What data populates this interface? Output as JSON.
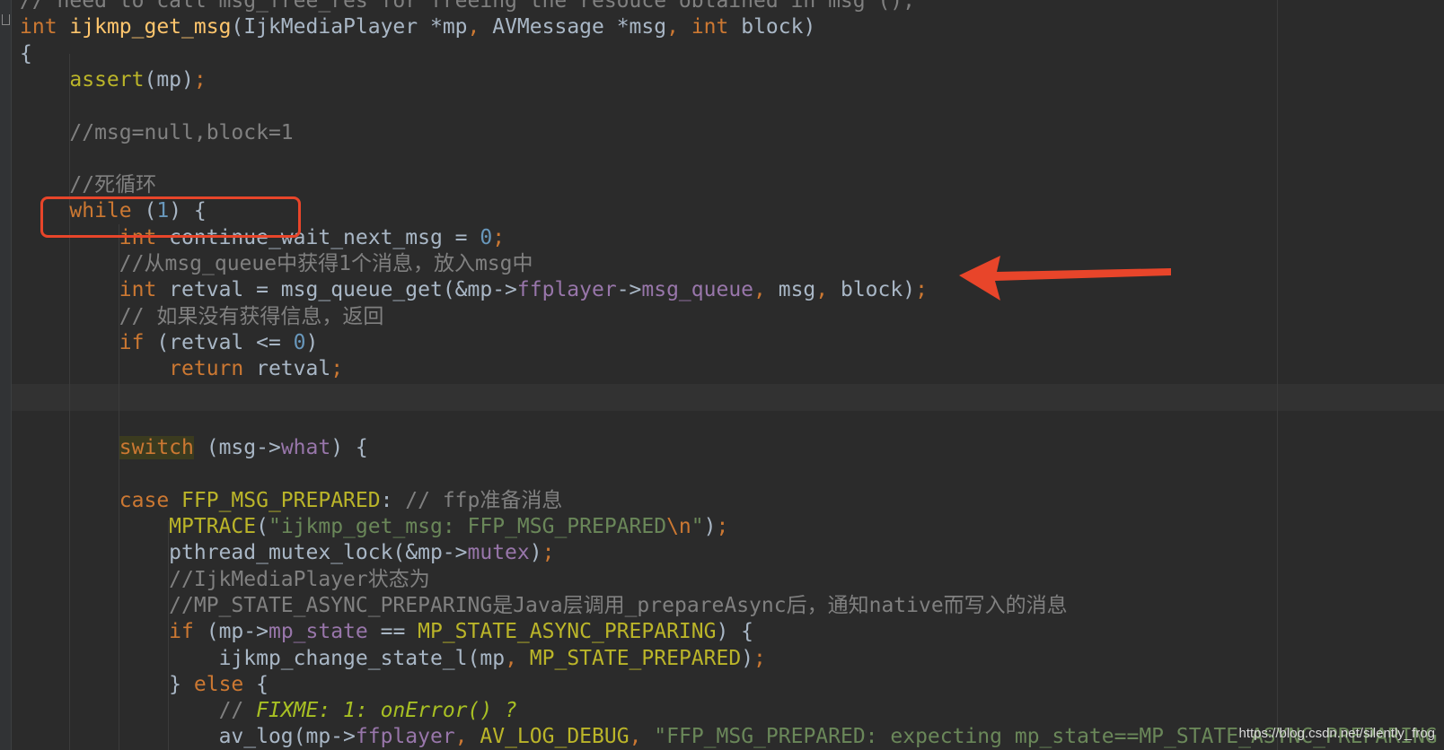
{
  "editor": {
    "lines": [
      {
        "segments": [
          {
            "t": "// need to call msg_free_res for freeing the resouce obtained in msg ();",
            "c": "cm"
          }
        ]
      },
      {
        "segments": [
          {
            "t": "int",
            "c": "kw"
          },
          {
            "t": " "
          },
          {
            "t": "ijkmp_get_msg",
            "c": "fn"
          },
          {
            "t": "(IjkMediaPlayer *mp"
          },
          {
            "t": ",",
            "c": "kw"
          },
          {
            "t": " AVMessage *msg"
          },
          {
            "t": ",",
            "c": "kw"
          },
          {
            "t": " "
          },
          {
            "t": "int",
            "c": "kw"
          },
          {
            "t": " block)"
          }
        ]
      },
      {
        "segments": [
          {
            "t": "{"
          }
        ]
      },
      {
        "segments": [
          {
            "t": "    "
          },
          {
            "t": "assert",
            "c": "mac"
          },
          {
            "t": "(mp)"
          },
          {
            "t": ";",
            "c": "kw"
          }
        ]
      },
      {
        "segments": [
          {
            "t": ""
          }
        ]
      },
      {
        "segments": [
          {
            "t": "    "
          },
          {
            "t": "//msg=null,block=1",
            "c": "cm"
          }
        ]
      },
      {
        "segments": [
          {
            "t": ""
          }
        ]
      },
      {
        "segments": [
          {
            "t": "    "
          },
          {
            "t": "//死循环",
            "c": "cm"
          }
        ]
      },
      {
        "segments": [
          {
            "t": "    "
          },
          {
            "t": "while",
            "c": "kw"
          },
          {
            "t": " ("
          },
          {
            "t": "1",
            "c": "num"
          },
          {
            "t": ") {"
          }
        ]
      },
      {
        "segments": [
          {
            "t": "        "
          },
          {
            "t": "int",
            "c": "kw"
          },
          {
            "t": " continue_wait_next_msg = "
          },
          {
            "t": "0",
            "c": "num"
          },
          {
            "t": ";",
            "c": "kw"
          }
        ]
      },
      {
        "segments": [
          {
            "t": "        "
          },
          {
            "t": "//从msg_queue中获得1个消息，放入msg中",
            "c": "cm"
          }
        ]
      },
      {
        "segments": [
          {
            "t": "        "
          },
          {
            "t": "int",
            "c": "kw"
          },
          {
            "t": " retval = msg_queue_get(&mp->"
          },
          {
            "t": "ffplayer",
            "c": "fld"
          },
          {
            "t": "->"
          },
          {
            "t": "msg_queue",
            "c": "fld"
          },
          {
            "t": ",",
            "c": "kw"
          },
          {
            "t": " msg"
          },
          {
            "t": ",",
            "c": "kw"
          },
          {
            "t": " block)"
          },
          {
            "t": ";",
            "c": "kw"
          }
        ]
      },
      {
        "segments": [
          {
            "t": "        "
          },
          {
            "t": "// 如果没有获得信息，返回",
            "c": "cm"
          }
        ]
      },
      {
        "segments": [
          {
            "t": "        "
          },
          {
            "t": "if",
            "c": "kw"
          },
          {
            "t": " (retval <= "
          },
          {
            "t": "0",
            "c": "num"
          },
          {
            "t": ")"
          }
        ]
      },
      {
        "segments": [
          {
            "t": "            "
          },
          {
            "t": "return",
            "c": "kw"
          },
          {
            "t": " retval"
          },
          {
            "t": ";",
            "c": "kw"
          }
        ]
      },
      {
        "segments": [
          {
            "t": ""
          }
        ]
      },
      {
        "segments": [
          {
            "t": ""
          }
        ]
      },
      {
        "segments": [
          {
            "t": "        "
          },
          {
            "t": "switch",
            "c": "sw-hl"
          },
          {
            "t": " (msg->"
          },
          {
            "t": "what",
            "c": "fld"
          },
          {
            "t": ") {"
          }
        ]
      },
      {
        "segments": [
          {
            "t": ""
          }
        ]
      },
      {
        "segments": [
          {
            "t": "        "
          },
          {
            "t": "case",
            "c": "kw"
          },
          {
            "t": " "
          },
          {
            "t": "FFP_MSG_PREPARED",
            "c": "mac"
          },
          {
            "t": ": "
          },
          {
            "t": "// ffp准备消息",
            "c": "cm"
          }
        ]
      },
      {
        "segments": [
          {
            "t": "            "
          },
          {
            "t": "MPTRACE",
            "c": "mac"
          },
          {
            "t": "("
          },
          {
            "t": "\"ijkmp_get_msg: FFP_MSG_PREPARED",
            "c": "str"
          },
          {
            "t": "\\n",
            "c": "esc"
          },
          {
            "t": "\"",
            "c": "str"
          },
          {
            "t": ")"
          },
          {
            "t": ";",
            "c": "kw"
          }
        ]
      },
      {
        "segments": [
          {
            "t": "            "
          },
          {
            "t": "pthread_mutex_lock(&mp->"
          },
          {
            "t": "mutex",
            "c": "fld"
          },
          {
            "t": ")"
          },
          {
            "t": ";",
            "c": "kw"
          }
        ]
      },
      {
        "segments": [
          {
            "t": "            "
          },
          {
            "t": "//IjkMediaPlayer状态为",
            "c": "cm"
          }
        ]
      },
      {
        "segments": [
          {
            "t": "            "
          },
          {
            "t": "//MP_STATE_ASYNC_PREPARING是Java层调用_prepareAsync后，通知native而写入的消息",
            "c": "cm"
          }
        ]
      },
      {
        "segments": [
          {
            "t": "            "
          },
          {
            "t": "if",
            "c": "kw"
          },
          {
            "t": " (mp->"
          },
          {
            "t": "mp_state",
            "c": "fld"
          },
          {
            "t": " == "
          },
          {
            "t": "MP_STATE_ASYNC_PREPARING",
            "c": "mac"
          },
          {
            "t": ") {"
          }
        ]
      },
      {
        "segments": [
          {
            "t": "                "
          },
          {
            "t": "ijkmp_change_state_l(mp"
          },
          {
            "t": ",",
            "c": "kw"
          },
          {
            "t": " "
          },
          {
            "t": "MP_STATE_PREPARED",
            "c": "mac"
          },
          {
            "t": ")"
          },
          {
            "t": ";",
            "c": "kw"
          }
        ]
      },
      {
        "segments": [
          {
            "t": "            "
          },
          {
            "t": "} "
          },
          {
            "t": "else",
            "c": "kw"
          },
          {
            "t": " {"
          }
        ]
      },
      {
        "segments": [
          {
            "t": "                "
          },
          {
            "t": "// ",
            "c": "cm"
          },
          {
            "t": "FIXME: 1: onError() ?",
            "c": "cmt-todo"
          }
        ]
      },
      {
        "segments": [
          {
            "t": "                "
          },
          {
            "t": "av_log(mp->"
          },
          {
            "t": "ffplayer",
            "c": "fld"
          },
          {
            "t": ",",
            "c": "kw"
          },
          {
            "t": " "
          },
          {
            "t": "AV_LOG_DEBUG",
            "c": "mac"
          },
          {
            "t": ",",
            "c": "kw"
          },
          {
            "t": " "
          },
          {
            "t": "\"FFP_MSG_PREPARED: expecting mp_state==MP_STATE_ASYNC_PREPARING",
            "c": "str"
          }
        ]
      }
    ]
  },
  "annotations": {
    "highlight_box_color": "#e8452a",
    "arrow_color": "#e8452a"
  },
  "watermark": "https://blog.csdn.net/silently_frog"
}
